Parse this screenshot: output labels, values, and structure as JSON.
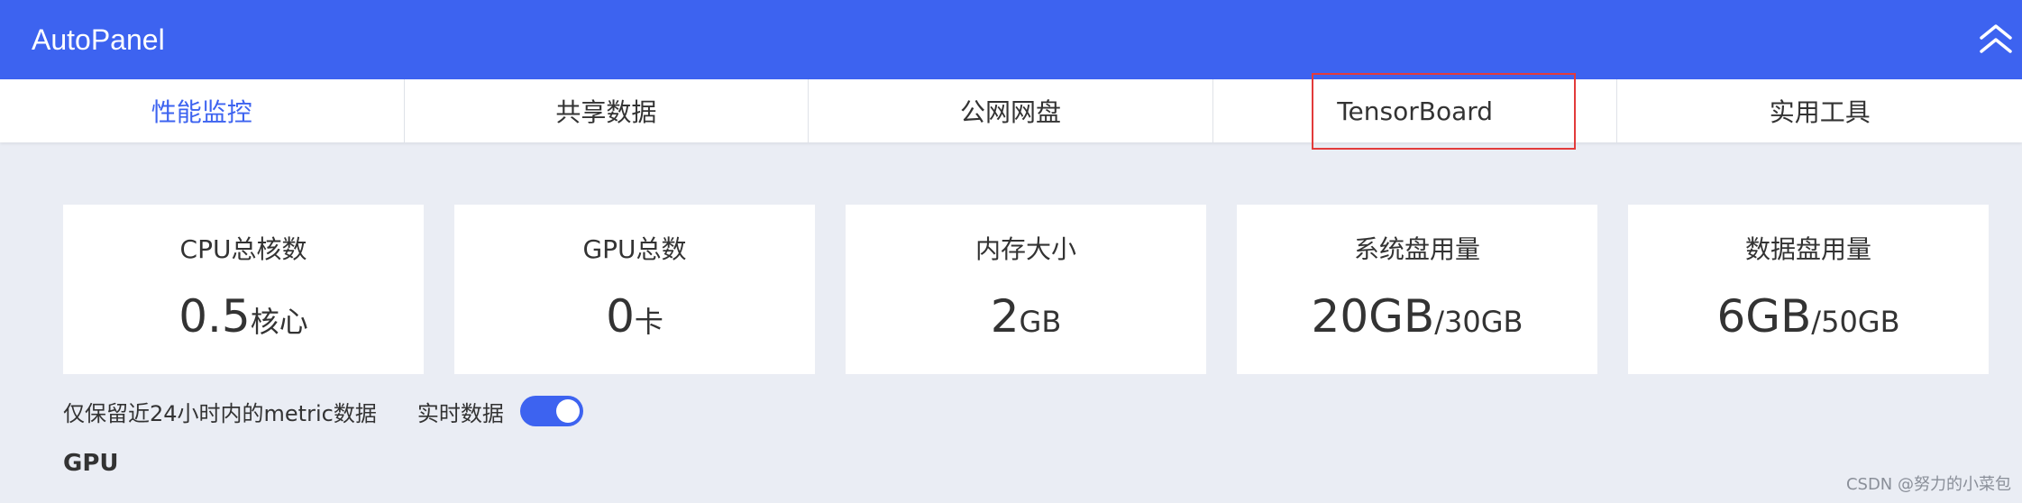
{
  "header": {
    "title": "AutoPanel",
    "collapse_icon": "double-chevron-up-icon",
    "background": "#3d63f0"
  },
  "tabs": [
    {
      "label": "性能监控",
      "active": true
    },
    {
      "label": "共享数据",
      "active": false
    },
    {
      "label": "公网网盘",
      "active": false
    },
    {
      "label": "TensorBoard",
      "active": false,
      "highlighted": true
    },
    {
      "label": "实用工具",
      "active": false
    }
  ],
  "cards": [
    {
      "label": "CPU总核数",
      "value": "0.5",
      "unit": "核心"
    },
    {
      "label": "GPU总数",
      "value": "0",
      "unit": "卡"
    },
    {
      "label": "内存大小",
      "value": "2",
      "unit": "GB"
    },
    {
      "label": "系统盘用量",
      "value": "20GB",
      "unit": "/30GB"
    },
    {
      "label": "数据盘用量",
      "value": "6GB",
      "unit": "/50GB"
    }
  ],
  "options": {
    "retention_note": "仅保留近24小时内的metric数据",
    "realtime_label": "实时数据",
    "realtime_enabled": true
  },
  "section": {
    "title": "GPU"
  },
  "watermark": "CSDN @努力的小菜包",
  "colors": {
    "accent": "#3d63f0",
    "highlight_border": "#e23b3b",
    "page_background": "#eaedf4"
  }
}
